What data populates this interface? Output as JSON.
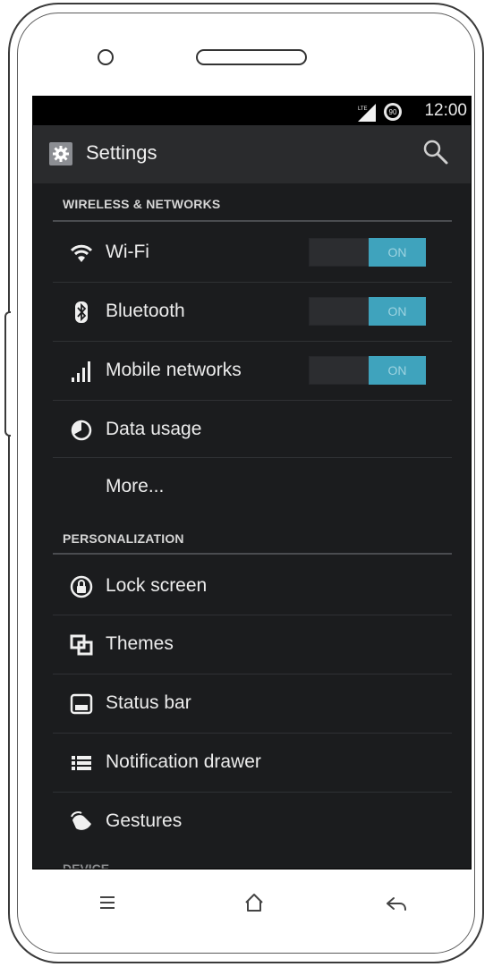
{
  "status_bar": {
    "network": "LTE",
    "battery": "90",
    "time": "12:00"
  },
  "action_bar": {
    "title": "Settings",
    "icons": {
      "app": "gear-icon",
      "search": "search-icon"
    }
  },
  "sections": [
    {
      "header": "WIRELESS & NETWORKS"
    },
    {
      "header": "PERSONALIZATION"
    },
    {
      "header": "DEVICE"
    }
  ],
  "wireless_items": [
    {
      "label": "Wi-Fi",
      "icon": "wifi-icon",
      "toggle": "ON"
    },
    {
      "label": "Bluetooth",
      "icon": "bluetooth-icon",
      "toggle": "ON"
    },
    {
      "label": "Mobile networks",
      "icon": "signal-icon",
      "toggle": "ON"
    },
    {
      "label": "Data usage",
      "icon": "data-usage-icon"
    },
    {
      "label": "More..."
    }
  ],
  "personalization_items": [
    {
      "label": "Lock screen",
      "icon": "lock-icon"
    },
    {
      "label": "Themes",
      "icon": "themes-icon"
    },
    {
      "label": "Status bar",
      "icon": "status-bar-icon"
    },
    {
      "label": "Notification drawer",
      "icon": "list-icon"
    },
    {
      "label": "Gestures",
      "icon": "gesture-icon"
    }
  ],
  "nav_buttons": {
    "menu": "menu-icon",
    "home": "home-icon",
    "back": "back-icon"
  },
  "colors": {
    "screen_bg": "#1b1c1e",
    "action_bar_bg": "#2a2b2d",
    "toggle_on": "#3fa3bd",
    "divider": "#4a4c50"
  }
}
